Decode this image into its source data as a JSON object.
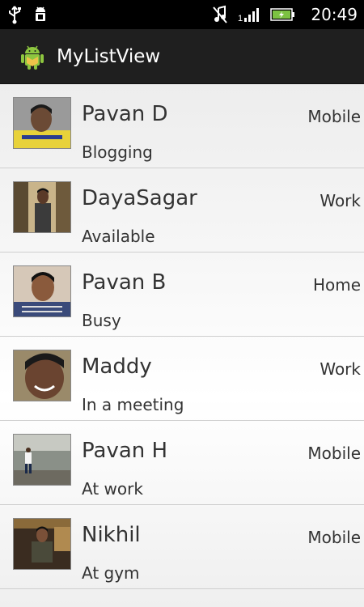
{
  "status_bar": {
    "time": "20:49",
    "icons": [
      "usb-icon",
      "android-debug-icon",
      "no-music-icon",
      "signal-icon",
      "battery-charging-icon"
    ]
  },
  "action_bar": {
    "title": "MyListView",
    "icon": "android-app-icon"
  },
  "contacts": [
    {
      "name": "Pavan D",
      "status": "Blogging",
      "type": "Mobile"
    },
    {
      "name": "DayaSagar",
      "status": "Available",
      "type": "Work"
    },
    {
      "name": "Pavan B",
      "status": "Busy",
      "type": "Home"
    },
    {
      "name": "Maddy",
      "status": "In a meeting",
      "type": "Work"
    },
    {
      "name": "Pavan H",
      "status": "At work",
      "type": "Mobile"
    },
    {
      "name": "Nikhil",
      "status": "At gym",
      "type": "Mobile"
    }
  ],
  "colors": {
    "status_bar_bg": "#000000",
    "action_bar_bg": "#1f1f1f",
    "text": "#333333",
    "android_green": "#8dc63f"
  }
}
